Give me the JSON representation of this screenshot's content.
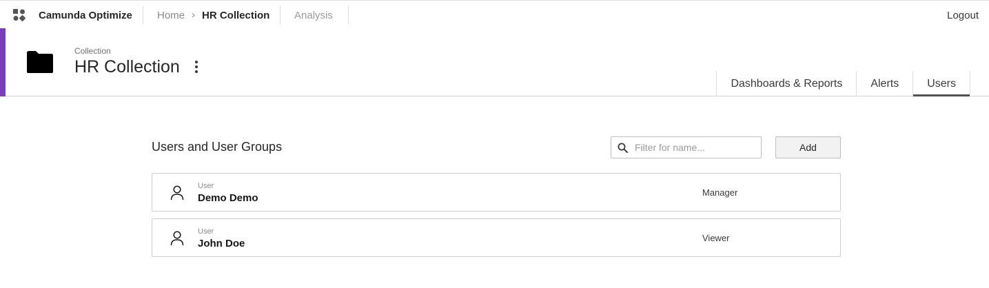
{
  "topnav": {
    "app_name": "Camunda Optimize",
    "breadcrumb": {
      "home": "Home",
      "separator": "›",
      "current": "HR Collection"
    },
    "analysis": "Analysis",
    "logout": "Logout",
    "logo_icon": "camunda-logo-icon"
  },
  "header": {
    "kicker": "Collection",
    "title": "HR Collection",
    "accent_color": "#7a3fb8",
    "icon": "folder-icon",
    "menu_icon": "kebab-menu-icon",
    "tabs": [
      {
        "label": "Dashboards & Reports",
        "active": false
      },
      {
        "label": "Alerts",
        "active": false
      },
      {
        "label": "Users",
        "active": true
      }
    ]
  },
  "main": {
    "section_title": "Users and User Groups",
    "search": {
      "placeholder": "Filter for name...",
      "value": ""
    },
    "add_label": "Add",
    "users": [
      {
        "type": "User",
        "name": "Demo Demo",
        "role": "Manager",
        "icon": "user-icon"
      },
      {
        "type": "User",
        "name": "John Doe",
        "role": "Viewer",
        "icon": "user-icon"
      }
    ]
  }
}
